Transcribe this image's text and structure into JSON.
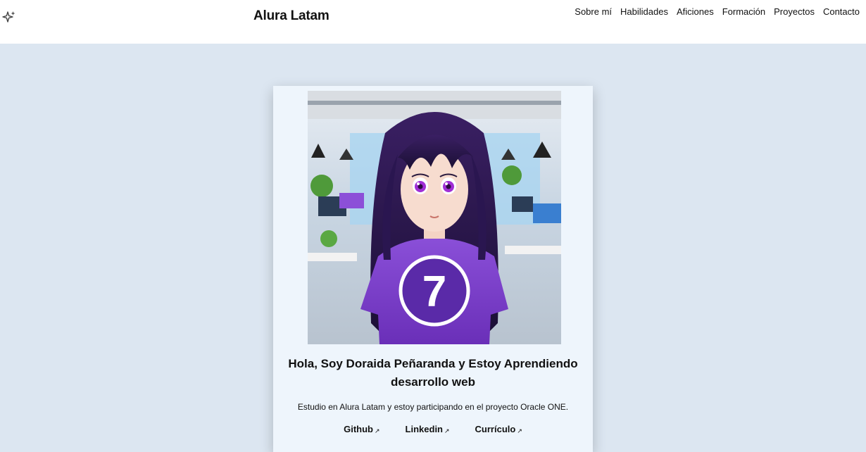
{
  "header": {
    "brand": "Alura Latam",
    "logo_icon": "sparkle-icon",
    "nav": [
      {
        "label": "Sobre mí"
      },
      {
        "label": "Habilidades"
      },
      {
        "label": "Aficiones"
      },
      {
        "label": "Formación"
      },
      {
        "label": "Proyectos"
      },
      {
        "label": "Contacto"
      }
    ]
  },
  "profile": {
    "image_alt": "Avatar illustration of a girl in a purple shirt in an office",
    "shirt_number": "7",
    "title": "Hola, Soy Doraida Peñaranda y Estoy Aprendiendo desarrollo web",
    "description": "Estudio en Alura Latam y estoy participando en el proyecto Oracle ONE.",
    "links": [
      {
        "label": "Github",
        "icon": "external-arrow-icon"
      },
      {
        "label": "Linkedin",
        "icon": "external-arrow-icon"
      },
      {
        "label": "Currículo",
        "icon": "external-arrow-icon"
      }
    ]
  },
  "colors": {
    "page_background": "#dce6f1",
    "card_background": "#eef5fc",
    "accent_purple": "#7b3fc4"
  }
}
